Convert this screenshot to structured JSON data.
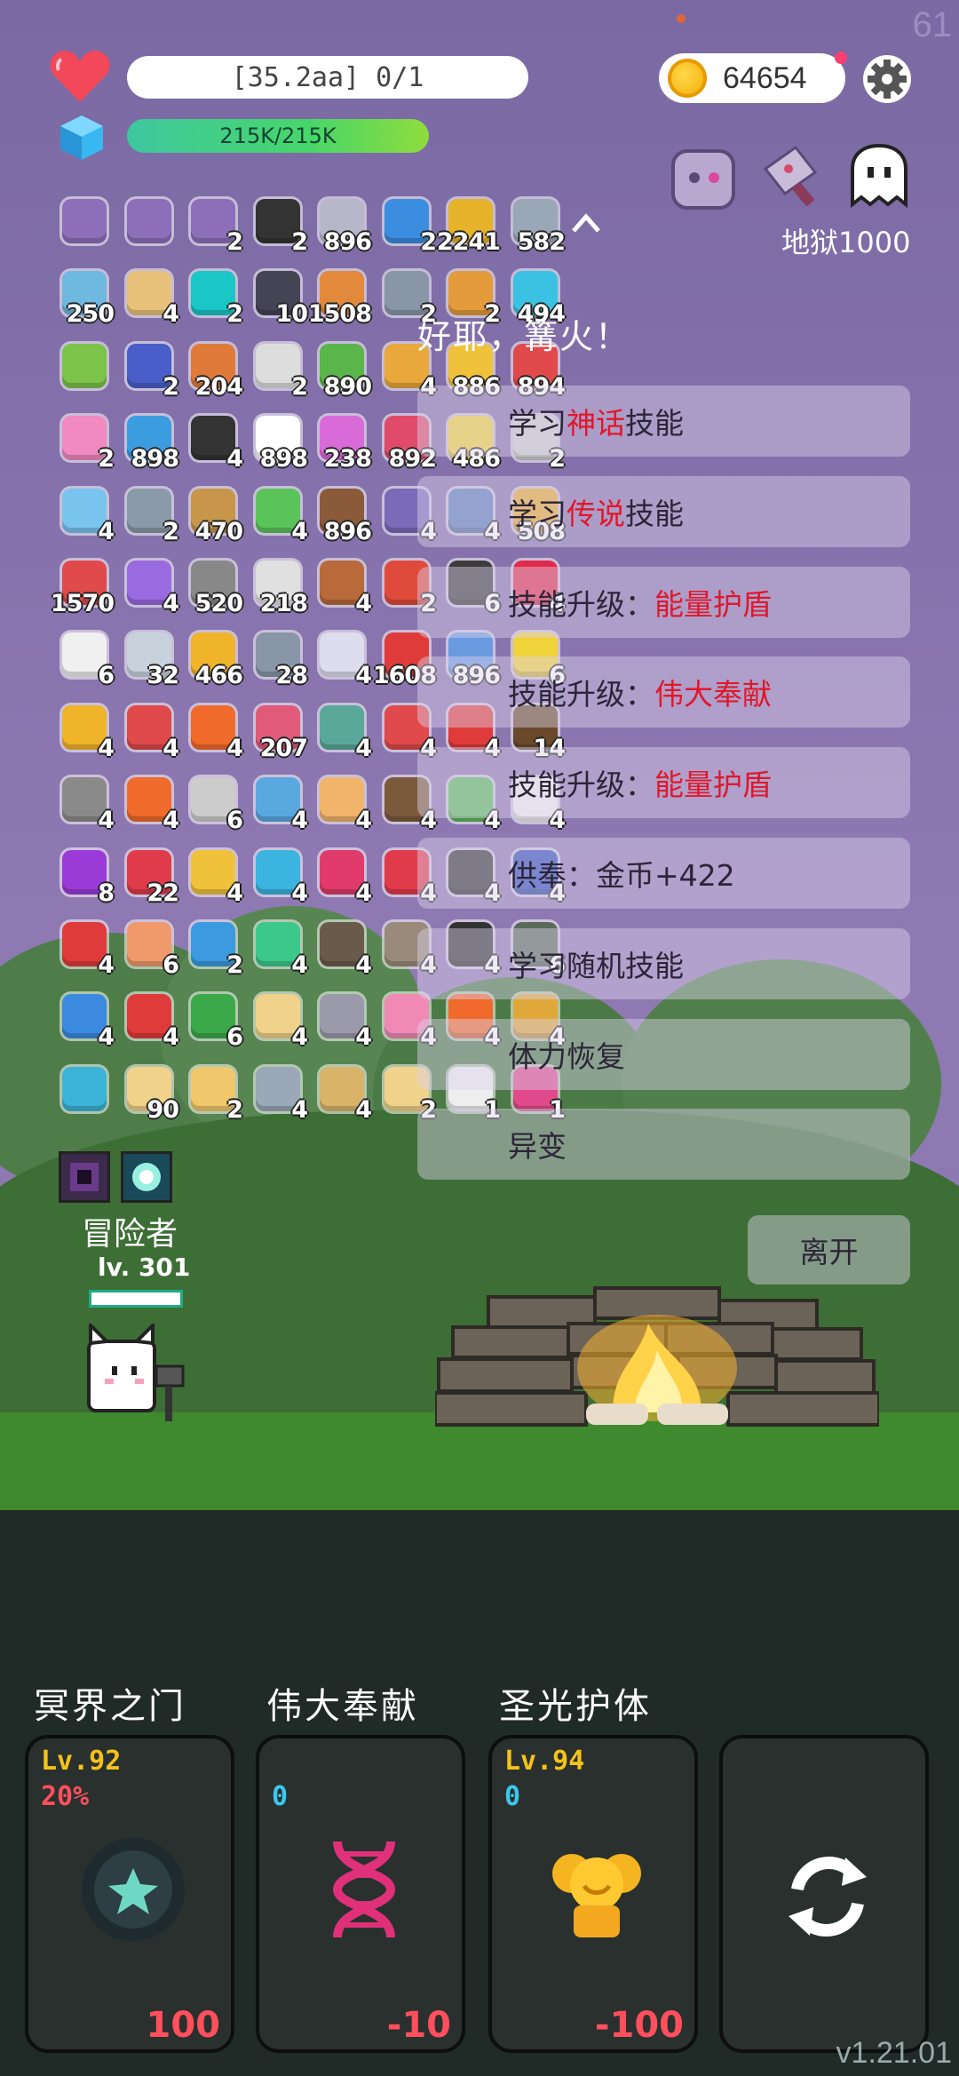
{
  "hud": {
    "hp_text": "[35.2aa] 0/1",
    "mp_text": "215K/215K",
    "gold": "64654",
    "fps": "61"
  },
  "stage": {
    "label": "地狱1000"
  },
  "items": [
    {
      "icon": "letter",
      "c": "#8c6fb8",
      "n": ""
    },
    {
      "icon": "letter",
      "c": "#8c6fb8",
      "n": ""
    },
    {
      "icon": "letter",
      "c": "#8c6fb8",
      "n": "2"
    },
    {
      "icon": "helmet",
      "c": "#333",
      "n": "2"
    },
    {
      "icon": "potion",
      "c": "#b7b7c9",
      "n": "896"
    },
    {
      "icon": "card",
      "c": "#3b8de0",
      "n": "2"
    },
    {
      "icon": "pineapple",
      "c": "#e6b32b",
      "n": "2241"
    },
    {
      "icon": "sword",
      "c": "#9aa7b7",
      "n": "582"
    },
    {
      "icon": "cloak",
      "c": "#6fb8e0",
      "n": "250"
    },
    {
      "icon": "scroll",
      "c": "#e8c27a",
      "n": "4"
    },
    {
      "icon": "swirl",
      "c": "#1ac6c6",
      "n": "2"
    },
    {
      "icon": "dagger",
      "c": "#445",
      "n": "10"
    },
    {
      "icon": "book",
      "c": "#e2893b",
      "n": "1508"
    },
    {
      "icon": "compass",
      "c": "#8896a8",
      "n": "2"
    },
    {
      "icon": "bag",
      "c": "#e39b3b",
      "n": "2"
    },
    {
      "icon": "pen",
      "c": "#3bc2e3",
      "n": "494"
    },
    {
      "icon": "lime",
      "c": "#7cc34a",
      "n": ""
    },
    {
      "icon": "hat",
      "c": "#4a5ec9",
      "n": "2"
    },
    {
      "icon": "meteor",
      "c": "#e07a3b",
      "n": "204"
    },
    {
      "icon": "cards",
      "c": "#ddd",
      "n": "2"
    },
    {
      "icon": "flask",
      "c": "#5ab54a",
      "n": "890"
    },
    {
      "icon": "scroll",
      "c": "#e8a83b",
      "n": "4"
    },
    {
      "icon": "beer",
      "c": "#f0c23b",
      "n": "886"
    },
    {
      "icon": "tube",
      "c": "#e04a4a",
      "n": "894"
    },
    {
      "icon": "icecream",
      "c": "#f08ac0",
      "n": "2"
    },
    {
      "icon": "bubble",
      "c": "#3b9de0",
      "n": "898"
    },
    {
      "icon": "bat",
      "c": "#333",
      "n": "4"
    },
    {
      "icon": "flower",
      "c": "#fff",
      "n": "898"
    },
    {
      "icon": "tulip",
      "c": "#d86bd8",
      "n": "238"
    },
    {
      "icon": "eraser",
      "c": "#e04a6b",
      "n": "892"
    },
    {
      "icon": "star",
      "c": "#f0d23b",
      "n": "486"
    },
    {
      "icon": "chain",
      "c": "#ccc",
      "n": "2"
    },
    {
      "icon": "frame",
      "c": "#7ac4f0",
      "n": "4"
    },
    {
      "icon": "mace",
      "c": "#8a9aa8",
      "n": "2"
    },
    {
      "icon": "bow",
      "c": "#c8964a",
      "n": "470"
    },
    {
      "icon": "tablet",
      "c": "#5ac45a",
      "n": "4"
    },
    {
      "icon": "donut",
      "c": "#8a5a3b",
      "n": "896"
    },
    {
      "icon": "dots",
      "c": "#7a6ab8",
      "n": "4"
    },
    {
      "icon": "hood",
      "c": "#5a7ab8",
      "n": "4"
    },
    {
      "icon": "pineapple",
      "c": "#e6a82b",
      "n": "508"
    },
    {
      "icon": "watermelon",
      "c": "#e04a4a",
      "n": "1570"
    },
    {
      "icon": "wand",
      "c": "#9a6ae0",
      "n": "4"
    },
    {
      "icon": "gravestone",
      "c": "#888",
      "n": "520"
    },
    {
      "icon": "flag",
      "c": "#e0e0e0",
      "n": "218"
    },
    {
      "icon": "meat",
      "c": "#b86a3b",
      "n": "4"
    },
    {
      "icon": "heat",
      "c": "#e04a3b",
      "n": "2"
    },
    {
      "icon": "eagle",
      "c": "#3b3b3b",
      "n": "6"
    },
    {
      "icon": "ruby",
      "c": "#e02a4a",
      "n": "4"
    },
    {
      "icon": "chat",
      "c": "#f0f0f0",
      "n": "6"
    },
    {
      "icon": "mail",
      "c": "#c8d2dc",
      "n": "32"
    },
    {
      "icon": "sunflower",
      "c": "#f0b42b",
      "n": "466"
    },
    {
      "icon": "cloud",
      "c": "#8896a8",
      "n": "28"
    },
    {
      "icon": "bulb",
      "c": "#dde",
      "n": "4"
    },
    {
      "icon": "apple",
      "c": "#e03b3b",
      "n": "1608"
    },
    {
      "icon": "pill",
      "c": "#6a9ae0",
      "n": "896"
    },
    {
      "icon": "sunny",
      "c": "#f0d23b",
      "n": "6"
    },
    {
      "icon": "wand",
      "c": "#f0b42b",
      "n": "4"
    },
    {
      "icon": "shield",
      "c": "#e04a4a",
      "n": "4"
    },
    {
      "icon": "fireball",
      "c": "#f06a2b",
      "n": "4"
    },
    {
      "icon": "jar",
      "c": "#e05a7a",
      "n": "207"
    },
    {
      "icon": "ghost",
      "c": "#5aa89a",
      "n": "4"
    },
    {
      "icon": "pin",
      "c": "#e04a4a",
      "n": "4"
    },
    {
      "icon": "magnet",
      "c": "#e03b3b",
      "n": "4"
    },
    {
      "icon": "coconut",
      "c": "#6a4a2b",
      "n": "14"
    },
    {
      "icon": "hook",
      "c": "#8a8a8a",
      "n": "4"
    },
    {
      "icon": "fire",
      "c": "#f06a2b",
      "n": "4"
    },
    {
      "icon": "question",
      "c": "#ccc",
      "n": "6"
    },
    {
      "icon": "pin2",
      "c": "#5aa8e0",
      "n": "4"
    },
    {
      "icon": "menu",
      "c": "#f0b46b",
      "n": "4"
    },
    {
      "icon": "mushroom",
      "c": "#7a5a3b",
      "n": "4"
    },
    {
      "icon": "tea",
      "c": "#5ab85a",
      "n": "4"
    },
    {
      "icon": "list",
      "c": "#eee",
      "n": "4"
    },
    {
      "icon": "orb",
      "c": "#9a3bd8",
      "n": "8"
    },
    {
      "icon": "strawberry",
      "c": "#e03b4a",
      "n": "22"
    },
    {
      "icon": "ring",
      "c": "#f0c23b",
      "n": "4"
    },
    {
      "icon": "scroll",
      "c": "#3bb4e0",
      "n": "4"
    },
    {
      "icon": "drop",
      "c": "#e03b6a",
      "n": "4"
    },
    {
      "icon": "shield2",
      "c": "#e03b4a",
      "n": "4"
    },
    {
      "icon": "cauldron",
      "c": "#333",
      "n": "4"
    },
    {
      "icon": "bible",
      "c": "#2a4ab8",
      "n": "4"
    },
    {
      "icon": "mushroom2",
      "c": "#e03b3b",
      "n": "4"
    },
    {
      "icon": "crown",
      "c": "#f09a6b",
      "n": "6"
    },
    {
      "icon": "target",
      "c": "#3b9ae0",
      "n": "2"
    },
    {
      "icon": "genie",
      "c": "#3bc88a",
      "n": "4"
    },
    {
      "icon": "mortar",
      "c": "#6a5a4a",
      "n": "4"
    },
    {
      "icon": "tomb",
      "c": "#9a8a7a",
      "n": "4"
    },
    {
      "icon": "bomb",
      "c": "#333",
      "n": "4"
    },
    {
      "icon": "zombie",
      "c": "#5a6a5a",
      "n": "6"
    },
    {
      "icon": "tools",
      "c": "#3b8ae0",
      "n": "4"
    },
    {
      "icon": "thermo",
      "c": "#e03b3b",
      "n": "4"
    },
    {
      "icon": "snake",
      "c": "#3ba84a",
      "n": "6"
    },
    {
      "icon": "angel",
      "c": "#f0d28a",
      "n": "4"
    },
    {
      "icon": "heart-plus",
      "c": "#9a9aaa",
      "n": "4"
    },
    {
      "icon": "calendar",
      "c": "#f08ab4",
      "n": "4"
    },
    {
      "icon": "firering",
      "c": "#f06a2b",
      "n": "4"
    },
    {
      "icon": "goblet",
      "c": "#e0a83b",
      "n": "4"
    },
    {
      "icon": "cycle",
      "c": "#3bb4d8",
      "n": ""
    },
    {
      "icon": "map",
      "c": "#f0d28a",
      "n": "90"
    },
    {
      "icon": "map2",
      "c": "#f0c86b",
      "n": "2"
    },
    {
      "icon": "swords",
      "c": "#9aa8b8",
      "n": "4"
    },
    {
      "icon": "map3",
      "c": "#d8b46b",
      "n": "4"
    },
    {
      "icon": "mapq",
      "c": "#f0d28a",
      "n": "2"
    },
    {
      "icon": "dice",
      "c": "#eee",
      "n": "1"
    },
    {
      "icon": "jar2",
      "c": "#e04a8a",
      "n": "1"
    }
  ],
  "campfire": {
    "title": "好耶，篝火！",
    "options": [
      {
        "pre": "学习",
        "hl": "神话",
        "post": "技能"
      },
      {
        "pre": "学习",
        "hl": "传说",
        "post": "技能"
      },
      {
        "pre": "技能升级：",
        "hl": "能量护盾",
        "post": ""
      },
      {
        "pre": "技能升级：",
        "hl": "伟大奉献",
        "post": ""
      },
      {
        "pre": "技能升级：",
        "hl": "能量护盾",
        "post": ""
      },
      {
        "pre": "供奉：金币+422",
        "hl": "",
        "post": ""
      },
      {
        "pre": "学习随机技能",
        "hl": "",
        "post": ""
      },
      {
        "pre": "体力恢复",
        "hl": "",
        "post": ""
      },
      {
        "pre": "异变",
        "hl": "",
        "post": ""
      }
    ],
    "leave": "离开"
  },
  "player": {
    "name": "冒险者",
    "level": "lv. 301"
  },
  "skills": [
    {
      "name": "冥界之门",
      "lv": "Lv.92",
      "pct": "20%",
      "cost": "100",
      "pct_color": "#ff4f5c"
    },
    {
      "name": "伟大奉献",
      "lv": "",
      "pct": "0",
      "cost": "-10",
      "pct_color": "#3bc8f0"
    },
    {
      "name": "圣光护体",
      "lv": "Lv.94",
      "pct": "0",
      "cost": "-100",
      "pct_color": "#3bc8f0"
    },
    {
      "name": "",
      "lv": "",
      "pct": "",
      "cost": "",
      "pct_color": ""
    }
  ],
  "version": "v1.21.01"
}
